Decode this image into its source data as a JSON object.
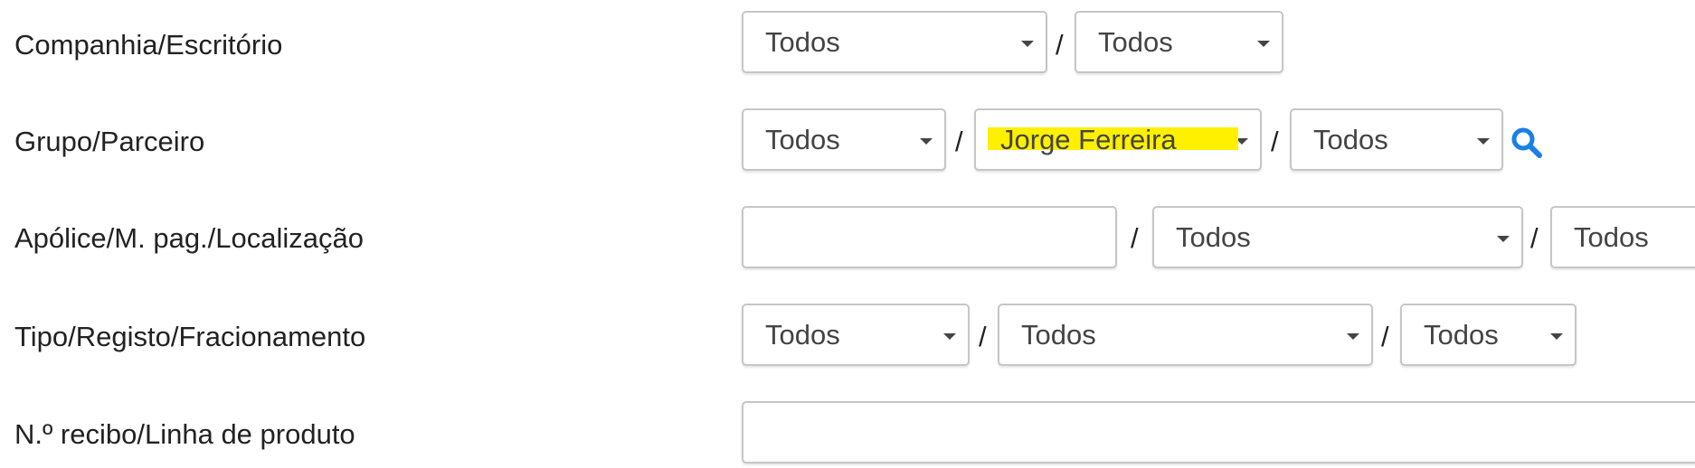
{
  "rows": [
    {
      "label": "Companhia/Escritório",
      "company_select": "Todos",
      "office_select": "Todos"
    },
    {
      "label": "Grupo/Parceiro",
      "group_select": "Todos",
      "partner_select": "Jorge Ferreira",
      "sub_partner_select": "Todos",
      "search_icon": "search-icon"
    },
    {
      "label": "Apólice/M. pag./Localização",
      "policy_input": "",
      "payment_select": "Todos",
      "location_select": "Todos"
    },
    {
      "label": "Tipo/Registo/Fracionamento",
      "type_select": "Todos",
      "registry_select": "Todos",
      "split_select": "Todos"
    },
    {
      "label": "N.º recibo/Linha de produto",
      "receipt_input": ""
    }
  ],
  "separator": "/",
  "colors": {
    "highlight": "#fff000",
    "search_icon": "#1a7fe6",
    "border": "#c6c6c6"
  }
}
